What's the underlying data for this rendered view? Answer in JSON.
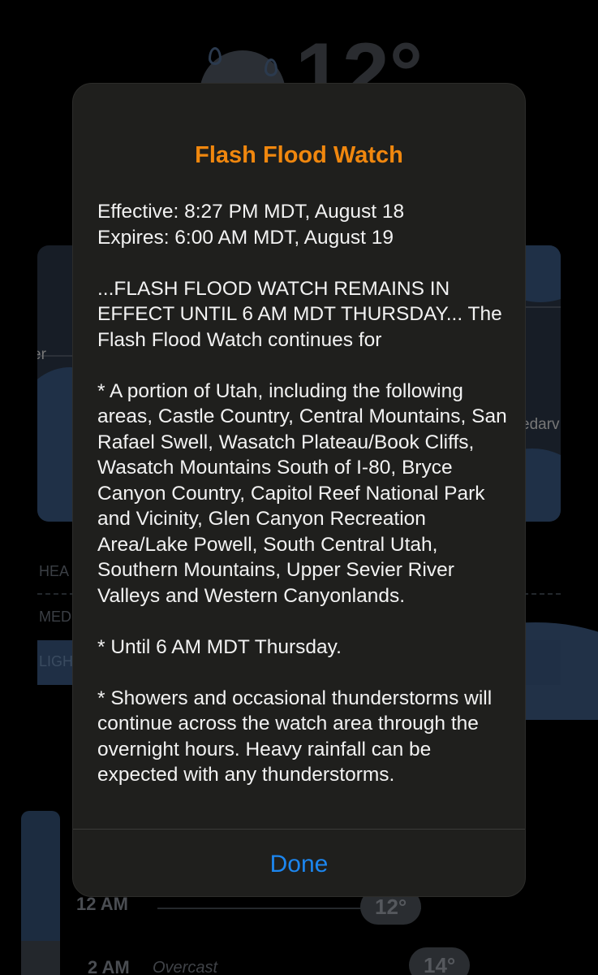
{
  "background": {
    "current_temp": "12°",
    "map_labels": {
      "left_partial": "er",
      "right_partial": "edarv"
    },
    "intensity_labels": [
      "HEA",
      "MED",
      "LIGH"
    ],
    "hourly": [
      {
        "time": "12 AM",
        "condition": "",
        "temp": "12°"
      },
      {
        "time": "2 AM",
        "condition": "Overcast",
        "temp": "14°"
      }
    ]
  },
  "alert": {
    "title": "Flash Flood Watch",
    "effective": "Effective: 8:27 PM MDT, August 18",
    "expires": "Expires: 6:00 AM MDT, August 19",
    "headline": "...FLASH FLOOD WATCH REMAINS IN EFFECT UNTIL 6 AM MDT THURSDAY... The Flash Flood Watch continues for",
    "areas": "* A portion of Utah, including the following areas, Castle Country, Central Mountains, San Rafael Swell, Wasatch Plateau/Book Cliffs, Wasatch Mountains South of I-80, Bryce Canyon Country, Capitol Reef National Park and Vicinity, Glen Canyon Recreation Area/Lake Powell, South Central Utah, Southern Mountains, Upper Sevier River Valleys and Western Canyonlands.",
    "until": "* Until 6 AM MDT Thursday.",
    "details": "* Showers and occasional thunderstorms will continue across the watch area through the overnight hours. Heavy rainfall can be expected with any thunderstorms.",
    "done_label": "Done"
  },
  "colors": {
    "alert_title": "#f0870e",
    "done_button": "#1c86ef",
    "modal_background": "#1f1f1d"
  }
}
